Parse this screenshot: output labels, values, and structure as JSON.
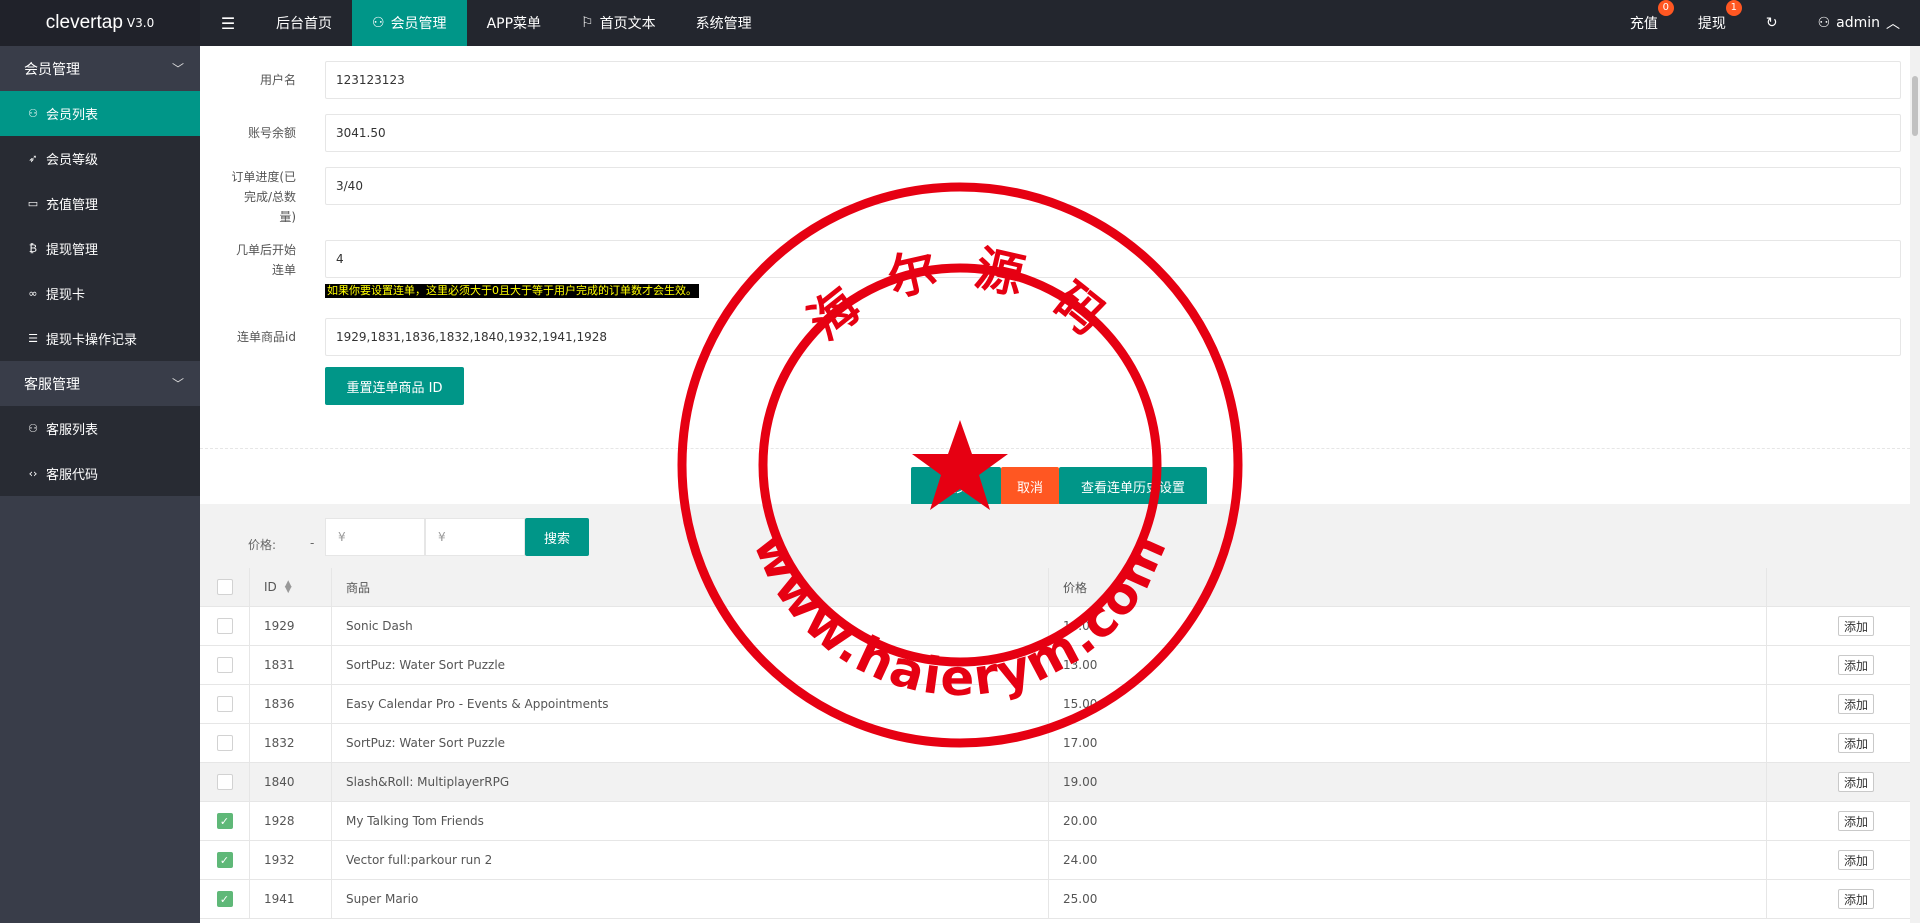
{
  "app": {
    "brand": "clevertap",
    "version": "V3.0"
  },
  "topnav": {
    "items": [
      {
        "label": "后台首页",
        "active": false
      },
      {
        "label": "会员管理",
        "active": true
      },
      {
        "label": "APP菜单",
        "active": false
      },
      {
        "label": "首页文本",
        "active": false
      },
      {
        "label": "系统管理",
        "active": false
      }
    ],
    "recharge": {
      "label": "充值",
      "badge": "0"
    },
    "withdraw": {
      "label": "提现",
      "badge": "1"
    },
    "user": "admin"
  },
  "sidebar": {
    "groups": [
      {
        "title": "会员管理",
        "items": [
          {
            "label": "会员列表",
            "icon": "user-icon",
            "active": true
          },
          {
            "label": "会员等级",
            "icon": "rocket-icon",
            "active": false
          },
          {
            "label": "充值管理",
            "icon": "monitor-icon",
            "active": false
          },
          {
            "label": "提现管理",
            "icon": "bitcoin-icon",
            "active": false
          },
          {
            "label": "提现卡",
            "icon": "link-icon",
            "active": false
          },
          {
            "label": "提现卡操作记录",
            "icon": "list-icon",
            "active": false
          }
        ]
      },
      {
        "title": "客服管理",
        "items": [
          {
            "label": "客服列表",
            "icon": "users-icon",
            "active": false
          },
          {
            "label": "客服代码",
            "icon": "code-icon",
            "active": false
          }
        ]
      }
    ]
  },
  "form": {
    "username": {
      "label": "用户名",
      "value": "123123123"
    },
    "balance": {
      "label": "账号余额",
      "value": "3041.50"
    },
    "progress": {
      "label": "订单进度(已完成/总数量)",
      "value": "3/40"
    },
    "start_after": {
      "label": "几单后开始连单",
      "value": "4"
    },
    "hint": "如果你要设置连单，这里必须大于0且大于等于用户完成的订单数才会生效。",
    "combo_ids": {
      "label": "连单商品id",
      "value": "1929,1831,1836,1832,1840,1932,1941,1928"
    },
    "reset_label": "重置连单商品 ID",
    "submit_label": "提交",
    "cancel_label": "取消",
    "history_label": "查看连单历史设置"
  },
  "search": {
    "price_label": "价格:",
    "dash": "-",
    "min_placeholder": "¥",
    "max_placeholder": "¥",
    "search_label": "搜索"
  },
  "table": {
    "columns": [
      "ID",
      "商品",
      "价格"
    ],
    "add_label": "添加",
    "rows": [
      {
        "id": "1929",
        "name": "Sonic Dash",
        "price": "10.00",
        "checked": false
      },
      {
        "id": "1831",
        "name": "SortPuz: Water Sort Puzzle",
        "price": "13.00",
        "checked": false
      },
      {
        "id": "1836",
        "name": "Easy Calendar Pro - Events & Appointments",
        "price": "15.00",
        "checked": false
      },
      {
        "id": "1832",
        "name": "SortPuz: Water Sort Puzzle",
        "price": "17.00",
        "checked": false
      },
      {
        "id": "1840",
        "name": "Slash&Roll: MultiplayerRPG",
        "price": "19.00",
        "checked": false
      },
      {
        "id": "1928",
        "name": "My Talking Tom Friends",
        "price": "20.00",
        "checked": true
      },
      {
        "id": "1932",
        "name": "Vector full:parkour run 2",
        "price": "24.00",
        "checked": true
      },
      {
        "id": "1941",
        "name": "Super Mario",
        "price": "25.00",
        "checked": true
      }
    ]
  },
  "watermark": {
    "text_top": "海 尔 源 码",
    "text_bottom": "www.haierym.com"
  },
  "colors": {
    "accent": "#009688",
    "warn": "#ff5722",
    "sidebar": "#393d49",
    "header": "#23262e",
    "stamp": "#e60012"
  }
}
